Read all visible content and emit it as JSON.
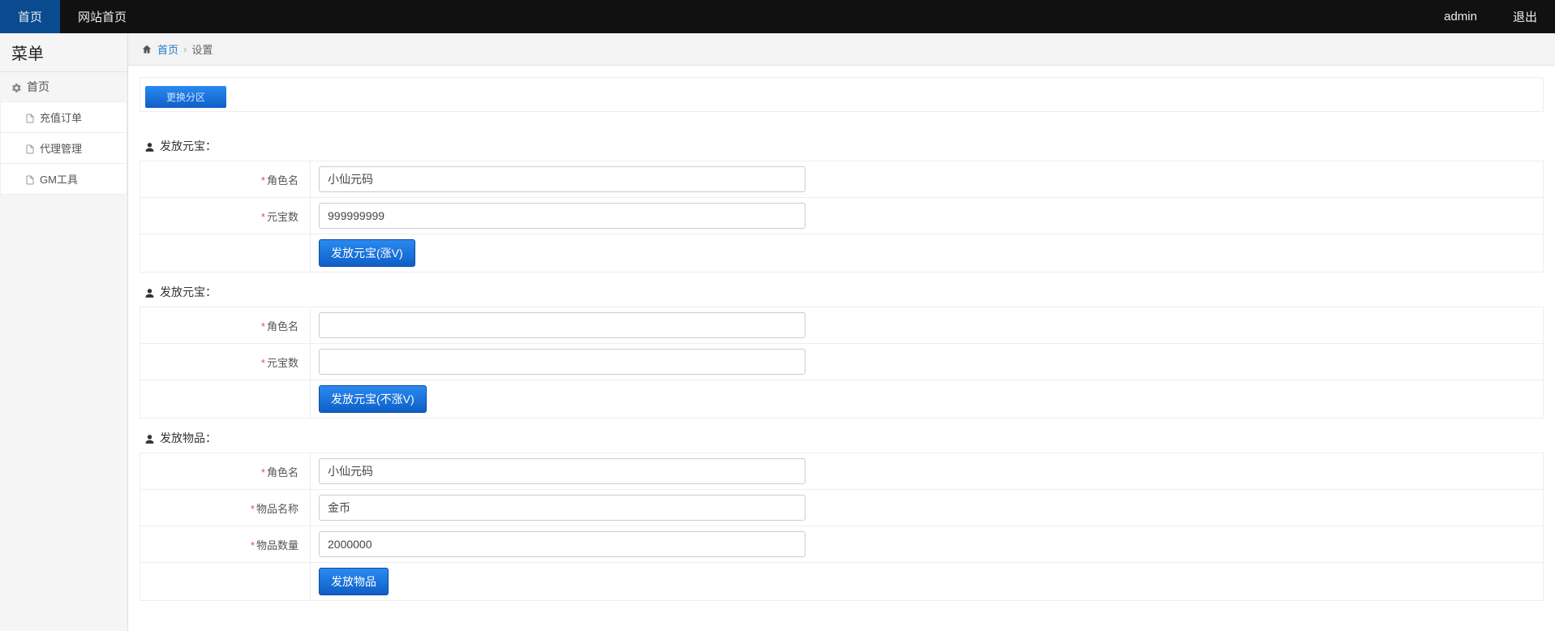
{
  "navbar": {
    "left": [
      {
        "label": "首页",
        "active": true
      },
      {
        "label": "网站首页",
        "active": false
      }
    ],
    "right": [
      {
        "label": "admin"
      },
      {
        "label": "退出"
      }
    ]
  },
  "sidebar": {
    "title": "菜单",
    "header": "首页",
    "items": [
      {
        "label": "充值订单"
      },
      {
        "label": "代理管理"
      },
      {
        "label": "GM工具"
      }
    ]
  },
  "breadcrumb": {
    "home_label": "首页",
    "current": "设置",
    "separator": "›"
  },
  "zone_button": "更换分区",
  "sections": {
    "s1": {
      "title": "发放元宝：",
      "role_label": "角色名",
      "role_value": "小仙元码",
      "amount_label": "元宝数",
      "amount_value": "999999999",
      "submit": "发放元宝(涨V)"
    },
    "s2": {
      "title": "发放元宝：",
      "role_label": "角色名",
      "role_value": "",
      "amount_label": "元宝数",
      "amount_value": "",
      "submit": "发放元宝(不涨V)"
    },
    "s3": {
      "title": "发放物品：",
      "role_label": "角色名",
      "role_value": "小仙元码",
      "item_label": "物品名称",
      "item_value": "金币",
      "qty_label": "物品数量",
      "qty_value": "2000000",
      "submit": "发放物品"
    }
  }
}
